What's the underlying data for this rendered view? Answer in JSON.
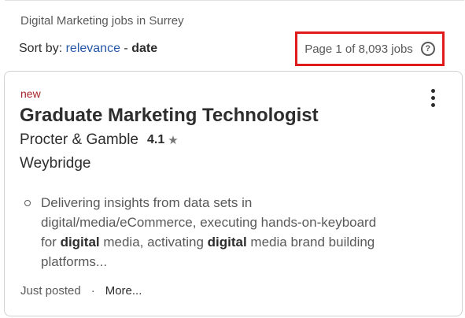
{
  "header": {
    "breadcrumb": "Digital Marketing jobs in Surrey",
    "sort_prefix": "Sort by:",
    "sort_relevance": "relevance",
    "sort_separator": "-",
    "sort_date": "date",
    "page_count": "Page 1 of 8,093 jobs",
    "help_icon": "question-circle-icon",
    "highlight_color": "#e01b1b",
    "link_color": "#2557a7"
  },
  "job": {
    "badge": "new",
    "badge_color": "#a9252b",
    "title": "Graduate Marketing Technologist",
    "company": "Procter & Gamble",
    "rating": "4.1",
    "rating_icon": "star-icon",
    "location": "Weybridge",
    "snippet": {
      "line1": "Delivering insights from data sets in",
      "line2": "digital/media/eCommerce, executing hands-on-keyboard",
      "line3_pre": "for ",
      "line3_bold1": "digital",
      "line3_mid": " media, activating ",
      "line3_bold2": "digital",
      "line3_post": " media brand building",
      "line4": "platforms..."
    },
    "posted": "Just posted",
    "footer_separator": "·",
    "more": "More..."
  }
}
